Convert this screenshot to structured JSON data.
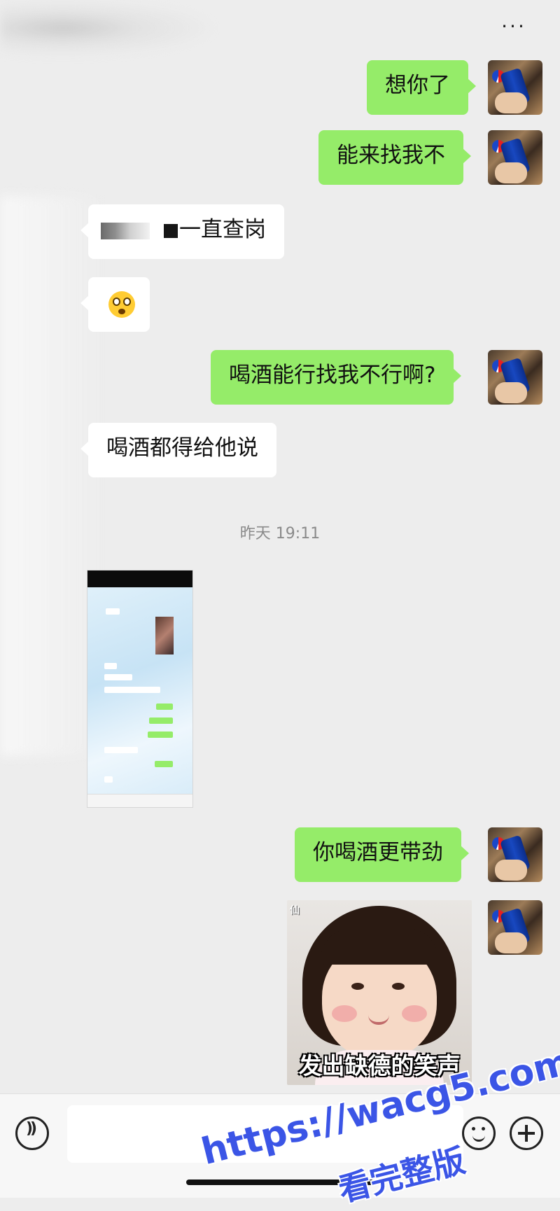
{
  "header": {
    "more_label": "···"
  },
  "messages": [
    {
      "side": "me",
      "text": "想你了"
    },
    {
      "side": "me",
      "text": "能来找我不"
    },
    {
      "side": "them",
      "text": "一直查岗"
    },
    {
      "side": "them",
      "emoji": "flushed-face"
    },
    {
      "side": "me",
      "text": "喝酒能行找我不行啊?"
    },
    {
      "side": "them",
      "text": "喝酒都得给他说"
    },
    {
      "side": "them",
      "image": "chat-screenshot"
    },
    {
      "side": "me",
      "text": "你喝酒更带劲"
    },
    {
      "side": "me",
      "sticker": "baby-smirk",
      "caption": "发出缺德的笑声"
    }
  ],
  "timestamp": "昨天 19:11",
  "sticker": {
    "caption": "发出缺德的笑声",
    "mark": "仙"
  },
  "watermark": {
    "url": "https://wacg5.com",
    "sub": "看完整版"
  },
  "colors": {
    "me_bubble": "#95ec69",
    "them_bubble": "#ffffff",
    "background": "#ededed",
    "watermark": "#3b55e6"
  }
}
